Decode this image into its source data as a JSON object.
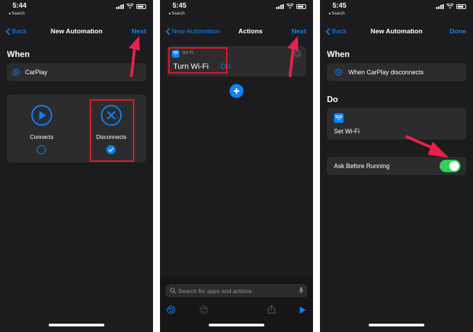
{
  "screen1": {
    "time": "5:44",
    "back_app": "◂ Search",
    "nav": {
      "back": "Back",
      "title": "New Automation",
      "action": "Next"
    },
    "when_header": "When",
    "trigger": "CarPlay",
    "options": [
      {
        "label": "Connects",
        "selected": false
      },
      {
        "label": "Disconnects",
        "selected": true
      }
    ]
  },
  "screen2": {
    "time": "5:45",
    "back_app": "◂ Search",
    "nav": {
      "back": "New Automation",
      "title": "Actions",
      "action": "Next"
    },
    "action_card": {
      "category": "Wi-Fi",
      "text": "Turn Wi-Fi",
      "value": "On"
    },
    "search": {
      "placeholder": "Search for apps and actions"
    }
  },
  "screen3": {
    "time": "5:45",
    "back_app": "◂ Search",
    "nav": {
      "back": "Back",
      "title": "New Automation",
      "action": "Done"
    },
    "when_header": "When",
    "trigger": "When CarPlay disconnects",
    "do_header": "Do",
    "do_action": "Set Wi-Fi",
    "ask_label": "Ask Before Running",
    "ask_toggle": "on"
  },
  "colors": {
    "accent": "#0a84ff",
    "toggle_on": "#30d158",
    "annotation": "#e11b22",
    "arrow": "#e8224a"
  }
}
